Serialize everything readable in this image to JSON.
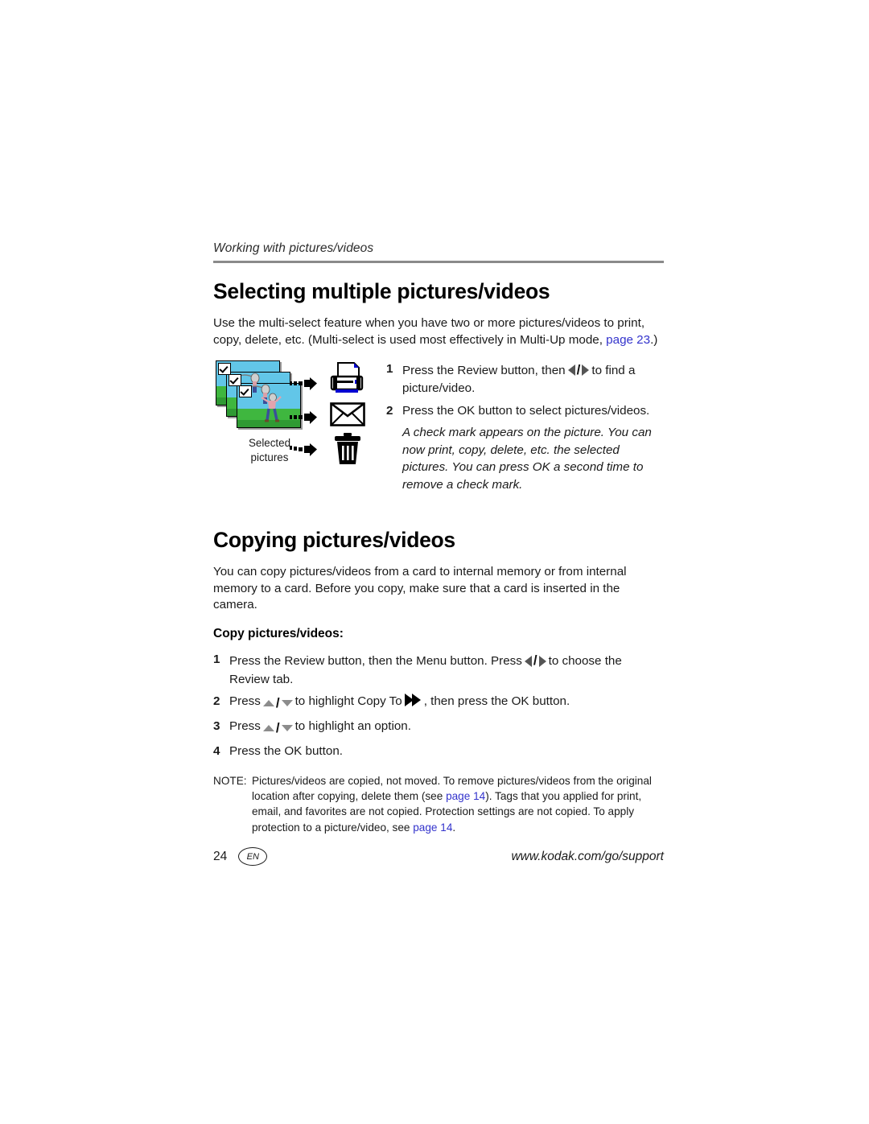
{
  "page": {
    "running_header": "Working with pictures/videos",
    "number": "24",
    "language_badge": "EN",
    "support_url": "www.kodak.com/go/support",
    "link_color": "#3333cc",
    "rule_color": "#8a8a8a"
  },
  "section_select": {
    "title": "Selecting multiple pictures/videos",
    "intro_part1": "Use the multi-select feature when you have two or more pictures/videos to print, copy, delete, etc. (Multi-select is used most effectively in Multi-Up mode, ",
    "intro_link": "page 23",
    "intro_part2": ".)",
    "steps": [
      {
        "num": "1",
        "text_before": "Press the Review button, then",
        "glyph": "left-right-arrow-glyph",
        "text_after": "to find a picture/video."
      },
      {
        "num": "2",
        "text_before": "Press the OK button to select pictures/videos.",
        "glyph": "",
        "text_after": ""
      }
    ],
    "italic_note": "A check mark appears on the picture. You can now print, copy, delete, etc. the selected pictures. You can press OK a second time to remove a check mark."
  },
  "figure": {
    "caption_line1": "Selected",
    "caption_line2": "pictures",
    "thumbnails": [
      {
        "name": "selected-picture-thumbnail-1",
        "checked": true
      },
      {
        "name": "selected-picture-thumbnail-2",
        "checked": true
      },
      {
        "name": "selected-picture-thumbnail-3",
        "checked": true
      }
    ],
    "destinations": [
      {
        "icon": "printer-icon",
        "label": "print"
      },
      {
        "icon": "envelope-icon",
        "label": "email"
      },
      {
        "icon": "trash-icon",
        "label": "delete"
      }
    ],
    "printer_accent_color": "#0000d0",
    "sky_color": "#62c6e8",
    "grass_color": "#3fb73f"
  },
  "section_copy": {
    "title": "Copying pictures/videos",
    "intro": "You can copy pictures/videos from a card to internal memory or from internal memory to a card. Before you copy, make sure that a card is inserted in the camera.",
    "subhead": "Copy pictures/videos:",
    "steps": [
      {
        "num": "1",
        "text_before": "Press the Review button, then the Menu button. Press",
        "glyph": "left-right-arrow-glyph",
        "text_after": "to choose the Review tab."
      },
      {
        "num": "2",
        "text_before": "Press",
        "glyph": "up-down-arrow-glyph",
        "text_mid": "to highlight Copy To",
        "glyph2": "copy-to-double-arrow-icon",
        "text_after": ", then press the OK button."
      },
      {
        "num": "3",
        "text_before": "Press",
        "glyph": "up-down-arrow-glyph",
        "text_after": "to highlight an option."
      },
      {
        "num": "4",
        "text_before": "Press the OK button.",
        "glyph": "",
        "text_after": ""
      }
    ],
    "note": {
      "label": "NOTE:",
      "part1": "Pictures/videos are copied, not moved. To remove pictures/videos from the original location after copying, delete them (see ",
      "link1": "page 14",
      "part2": "). Tags that you applied for print, email, and favorites are not copied. Protection settings are not copied. To apply protection to a picture/video, see ",
      "link2": "page 14",
      "part3": "."
    }
  }
}
